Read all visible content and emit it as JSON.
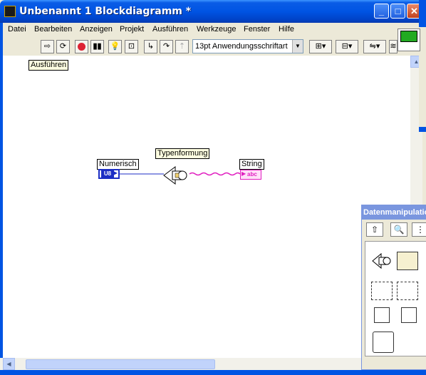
{
  "window": {
    "title": "Unbenannt 1 Blockdiagramm *"
  },
  "menu": [
    "Datei",
    "Bearbeiten",
    "Anzeigen",
    "Projekt",
    "Ausführen",
    "Werkzeuge",
    "Fenster",
    "Hilfe"
  ],
  "toolbar": {
    "font": "13pt Anwendungsschriftart"
  },
  "diagram": {
    "run_label": "Ausführen",
    "numeric_label": "Numerisch",
    "numeric_type": "U8",
    "cast_label": "Typenformung",
    "string_label": "String",
    "string_type": "abc"
  },
  "palette": {
    "title": "Datenmanipulation"
  },
  "colors": {
    "numeric_wire": "#1c2ec4",
    "string_wire": "#e020c0"
  }
}
